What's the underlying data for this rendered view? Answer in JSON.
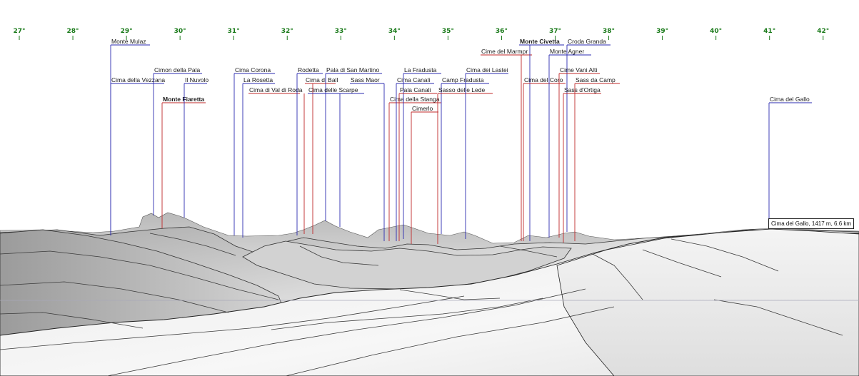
{
  "colors": {
    "tick": "#1a7a1a",
    "line_blue": "#2b2bb0",
    "line_red": "#c0282a",
    "terrain_light": "#f2f2f2",
    "terrain_dark": "#8c8c8c",
    "horizon_ref": "#a8a8b8"
  },
  "ticks": [
    "27°",
    "28°",
    "29°",
    "30°",
    "31°",
    "32°",
    "33°",
    "34°",
    "35°",
    "36°",
    "37°",
    "38°",
    "39°",
    "40°",
    "41°",
    "42°"
  ],
  "peaks": [
    {
      "name": "Monte Mulaz",
      "color": "blue"
    },
    {
      "name": "Cima della Vezzana",
      "color": "blue"
    },
    {
      "name": "Cimon della Pala",
      "color": "blue"
    },
    {
      "name": "Monte Fiaretta",
      "color": "red",
      "bold": true
    },
    {
      "name": "Il Nuvolo",
      "color": "blue"
    },
    {
      "name": "Cima Corona",
      "color": "blue"
    },
    {
      "name": "La Rosetta",
      "color": "blue"
    },
    {
      "name": "Cima di Val di Roda",
      "color": "red"
    },
    {
      "name": "Rodetta",
      "color": "blue"
    },
    {
      "name": "Cima di Ball",
      "color": "red"
    },
    {
      "name": "Pala di San Martino",
      "color": "blue"
    },
    {
      "name": "Cima delle Scarpe",
      "color": "blue"
    },
    {
      "name": "Sass Maor",
      "color": "blue"
    },
    {
      "name": "Cima della Stanga",
      "color": "red"
    },
    {
      "name": "Cima Canali",
      "color": "blue"
    },
    {
      "name": "La Fradusta",
      "color": "blue"
    },
    {
      "name": "Pala Canali",
      "color": "red"
    },
    {
      "name": "Cimerlo",
      "color": "red"
    },
    {
      "name": "Camp Fradusta",
      "color": "blue"
    },
    {
      "name": "Sasso delle Lede",
      "color": "red"
    },
    {
      "name": "Cima dei Lastei",
      "color": "blue"
    },
    {
      "name": "Cime del Marmpr",
      "color": "red"
    },
    {
      "name": "Monte Civetta",
      "color": "blue",
      "bold": true
    },
    {
      "name": "Cima del Coro",
      "color": "red"
    },
    {
      "name": "Monte Agner",
      "color": "blue"
    },
    {
      "name": "Croda Granda",
      "color": "blue"
    },
    {
      "name": "Cime Vani Alti",
      "color": "red"
    },
    {
      "name": "Sass d'Ortiga",
      "color": "red"
    },
    {
      "name": "Sass da Camp",
      "color": "red"
    },
    {
      "name": "Cima del Gallo",
      "color": "blue"
    }
  ],
  "tooltip": "Cima del Gallo, 1417 m, 6.6 km"
}
